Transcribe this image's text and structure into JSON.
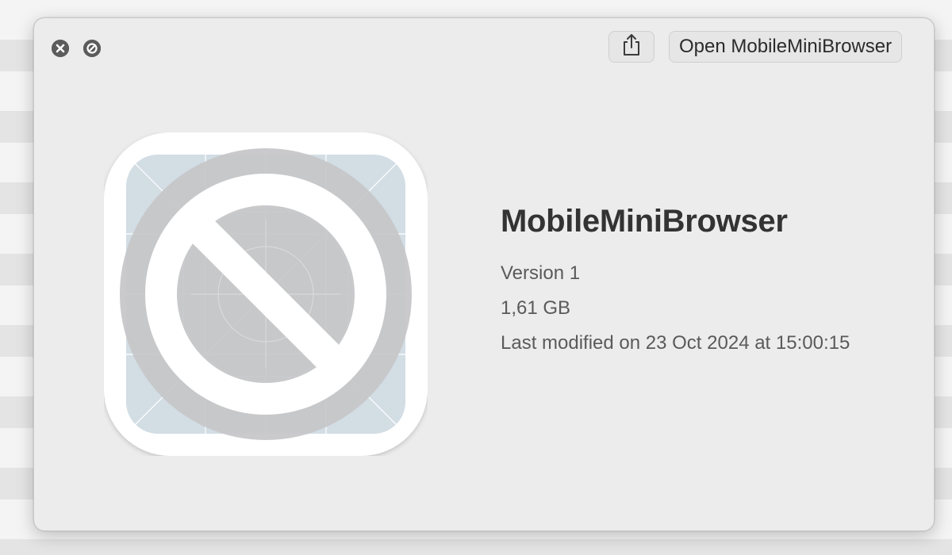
{
  "window": {
    "close_icon": "close-circle-icon",
    "block_icon": "prohibited-circle-icon"
  },
  "toolbar": {
    "share_icon": "share-icon",
    "open_label": "Open MobileMiniBrowser"
  },
  "app": {
    "icon": "prohibited-app-icon",
    "name": "MobileMiniBrowser",
    "version": "Version 1",
    "size": "1,61 GB",
    "modified": "Last modified on 23 Oct 2024 at 15:00:15"
  },
  "colors": {
    "panel_bg": "#ececec",
    "icon_tile_bg": "#d2dde4",
    "icon_symbol": "#c5c6c8",
    "title_text": "#333333",
    "meta_text": "#5a5a5a"
  }
}
